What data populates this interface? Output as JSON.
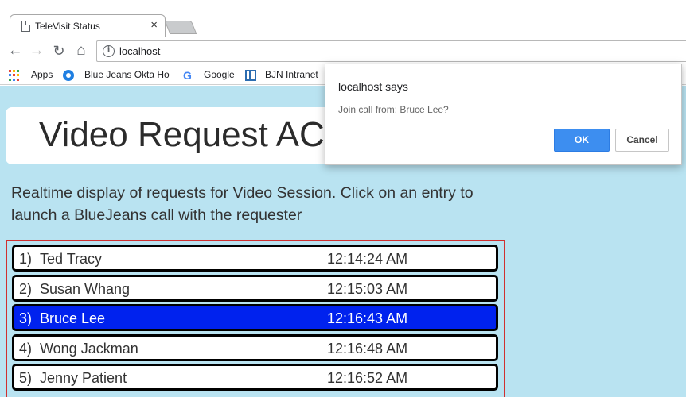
{
  "browser": {
    "tab_title": "TeleVisit Status",
    "tab_close": "×",
    "url": "localhost",
    "bookmarks": [
      {
        "label": "Apps",
        "icon": "apps-grid-icon"
      },
      {
        "label": "Blue Jeans Okta Hon",
        "icon": "okta-icon"
      },
      {
        "label": "Google",
        "icon": "google-icon"
      },
      {
        "label": "BJN Intranet",
        "icon": "bjn-icon"
      }
    ],
    "apps_colors": [
      "#ea4335",
      "#fbbc05",
      "#34a853",
      "#4285f4",
      "#ea4335",
      "#fbbc05",
      "#34a853",
      "#4285f4",
      "#ea4335"
    ]
  },
  "page": {
    "title": "Video Request ACD",
    "description": "Realtime display of requests for Video Session. Click on an entry to launch a BlueJeans call with the requester",
    "background": "#b9e3f1",
    "requests": [
      {
        "num": "1)",
        "name": "Ted Tracy",
        "time": "12:14:24 AM",
        "selected": false
      },
      {
        "num": "2)",
        "name": "Susan Whang",
        "time": "12:15:03 AM",
        "selected": false
      },
      {
        "num": "3)",
        "name": "Bruce Lee",
        "time": "12:16:43 AM",
        "selected": true
      },
      {
        "num": "4)",
        "name": "Wong Jackman",
        "time": "12:16:48 AM",
        "selected": false
      },
      {
        "num": "5)",
        "name": "Jenny Patient",
        "time": "12:16:52 AM",
        "selected": false
      }
    ]
  },
  "dialog": {
    "title": "localhost says",
    "message": "Join call from: Bruce Lee?",
    "ok_label": "OK",
    "cancel_label": "Cancel"
  }
}
